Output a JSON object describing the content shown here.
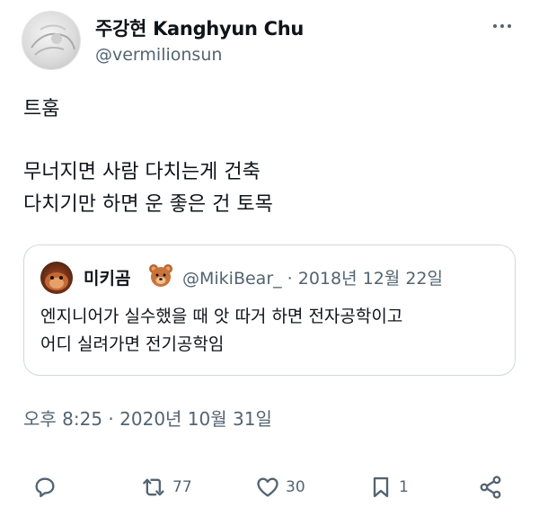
{
  "author": {
    "display_name": "주강현 Kanghyun Chu",
    "handle": "@vermilionsun"
  },
  "tweet": {
    "line1": "트훔",
    "line2": "무너지면 사람 다치는게 건축",
    "line3": "다치기만 하면 운 좋은 건 토목"
  },
  "quote": {
    "name": "미키곰",
    "emoji": "bear-face-icon",
    "meta": "@MikiBear_ · 2018년 12월 22일",
    "line1": "엔지니어가 실수했을 때 앗 따거 하면 전자공학이고",
    "line2": "어디 실려가면 전기공학임"
  },
  "timestamp": "오후 8:25 · 2020년 10월 31일",
  "actions": {
    "reply": {
      "icon": "reply-icon",
      "count": ""
    },
    "retweet": {
      "icon": "retweet-icon",
      "count": "77"
    },
    "like": {
      "icon": "heart-icon",
      "count": "30"
    },
    "bookmark": {
      "icon": "bookmark-icon",
      "count": "1"
    },
    "share": {
      "icon": "share-icon",
      "count": ""
    }
  },
  "colors": {
    "text": "#0f1419",
    "secondary": "#536471",
    "border": "#cfd9de"
  }
}
